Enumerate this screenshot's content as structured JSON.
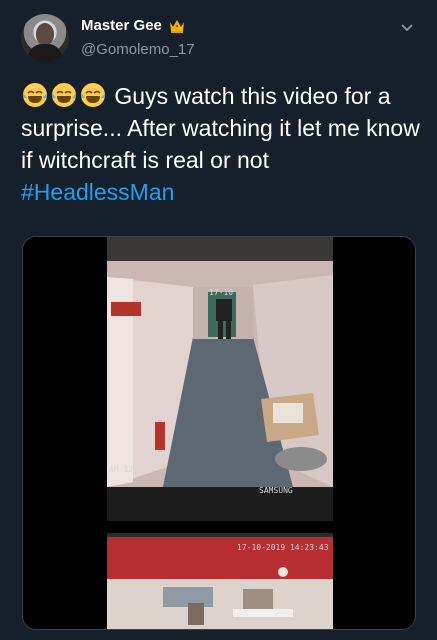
{
  "author": {
    "display_name": "Master Gee",
    "handle": "@Gomolemo_17",
    "badge_icon": "crown-icon"
  },
  "tweet": {
    "text": "Guys watch this video for a surprise... After watching it let me know if witchcraft is real or not",
    "hashtag": "#HeadlessMan",
    "leading_emojis": [
      "laughing-tears-icon",
      "laughing-tears-icon",
      "laughing-tears-icon"
    ]
  },
  "media": {
    "top_overlay_timestamp": "17-10",
    "upper_left_label": "AM 12",
    "monitor_brand": "SAMSUNG",
    "bottom_timestamp": "17-10-2019 14:23:43"
  },
  "colors": {
    "background": "#15202b",
    "text": "#ffffff",
    "muted": "#8899a6",
    "link": "#1da1f2"
  }
}
